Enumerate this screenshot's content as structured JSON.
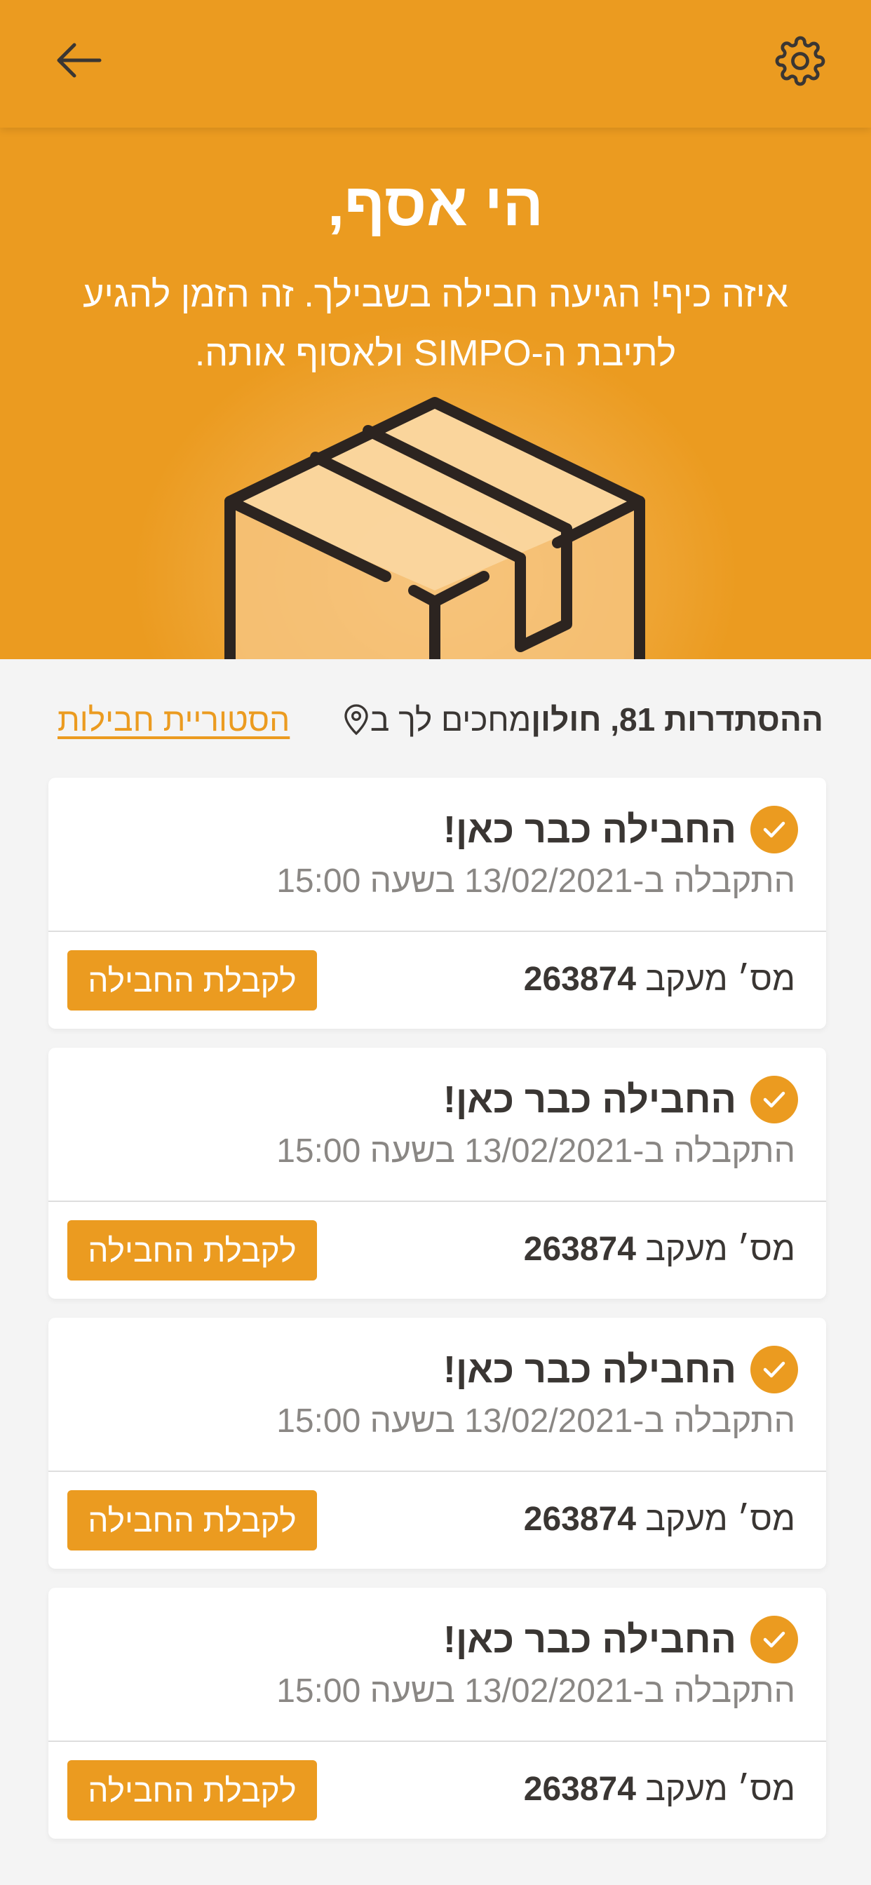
{
  "header": {
    "back_icon": "arrow-left-icon",
    "settings_icon": "gear-icon"
  },
  "hero": {
    "greeting": "הי אסף,",
    "message": "איזה כיף! הגיעה חבילה בשבילך. זה הזמן להגיע לתיבת ה-SIMPO ולאסוף אותה.",
    "illustration": "package-box-icon"
  },
  "location": {
    "icon": "location-pin-icon",
    "prefix": "מחכים לך ב",
    "address": "ההסתדרות 81, חולון"
  },
  "history_link": "הסטוריית חבילות",
  "packages": [
    {
      "title": "החבילה כבר כאן!",
      "received": "התקבלה ב-13/02/2021 בשעה 15:00",
      "tracking_label": "מס׳ מעקב",
      "tracking_number": "263874",
      "button": "לקבלת החבילה"
    },
    {
      "title": "החבילה כבר כאן!",
      "received": "התקבלה ב-13/02/2021 בשעה 15:00",
      "tracking_label": "מס׳ מעקב",
      "tracking_number": "263874",
      "button": "לקבלת החבילה"
    },
    {
      "title": "החבילה כבר כאן!",
      "received": "התקבלה ב-13/02/2021 בשעה 15:00",
      "tracking_label": "מס׳ מעקב",
      "tracking_number": "263874",
      "button": "לקבלת החבילה"
    },
    {
      "title": "החבילה כבר כאן!",
      "received": "התקבלה ב-13/02/2021 בשעה 15:00",
      "tracking_label": "מס׳ מעקב",
      "tracking_number": "263874",
      "button": "לקבלת החבילה"
    }
  ],
  "colors": {
    "accent": "#eb9b20",
    "text": "#3a3633",
    "muted": "#8a8784",
    "background": "#f4f4f4"
  }
}
